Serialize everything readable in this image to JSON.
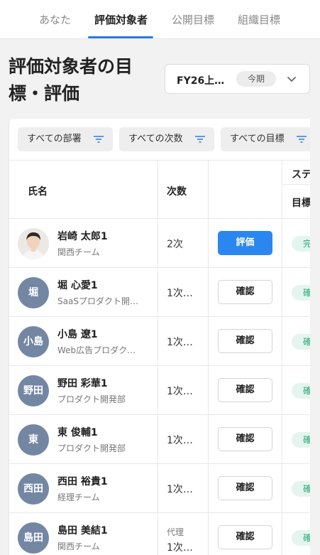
{
  "tabs": [
    {
      "label": "あなた"
    },
    {
      "label": "評価対象者"
    },
    {
      "label": "公開目標"
    },
    {
      "label": "組織目標"
    }
  ],
  "header": {
    "title": "評価対象者の目標・評価",
    "period": "FY26上…",
    "period_badge": "今期"
  },
  "filters": [
    {
      "label": "すべての部署"
    },
    {
      "label": "すべての次数"
    },
    {
      "label": "すべての目標"
    }
  ],
  "table": {
    "columns": {
      "name": "氏名",
      "level": "次数",
      "status_group": "ステ",
      "status_goal": "目標"
    },
    "rows": [
      {
        "avatar": "",
        "name": "岩崎 太郎1",
        "dept": "関西チーム",
        "level": "2次",
        "level_sub": "",
        "action": "評価",
        "status": "完"
      },
      {
        "avatar": "堀",
        "name": "堀 心愛1",
        "dept": "SaaSプロダクト開…",
        "level": "1次…",
        "level_sub": "",
        "action": "確認",
        "status": "確"
      },
      {
        "avatar": "小島",
        "name": "小島 遼1",
        "dept": "Web広告プロダク…",
        "level": "1次…",
        "level_sub": "",
        "action": "確認",
        "status": "確"
      },
      {
        "avatar": "野田",
        "name": "野田 彩華1",
        "dept": "プロダクト開発部",
        "level": "1次…",
        "level_sub": "",
        "action": "確認",
        "status": "確"
      },
      {
        "avatar": "東",
        "name": "東 俊輔1",
        "dept": "プロダクト開発部",
        "level": "1次…",
        "level_sub": "",
        "action": "確認",
        "status": "確"
      },
      {
        "avatar": "西田",
        "name": "西田 裕貴1",
        "dept": "経理チーム",
        "level": "1次…",
        "level_sub": "",
        "action": "確認",
        "status": "確"
      },
      {
        "avatar": "島田",
        "name": "島田 美結1",
        "dept": "関西チーム",
        "level": "1次…",
        "level_sub": "代理",
        "action": "確認",
        "status": "確"
      }
    ]
  },
  "colors": {
    "accent": "#2b7be4",
    "primary_button": "#2b86f0",
    "avatar_bg": "#7387a3",
    "status_bg": "#e3f5ee",
    "status_text": "#2aa878"
  }
}
